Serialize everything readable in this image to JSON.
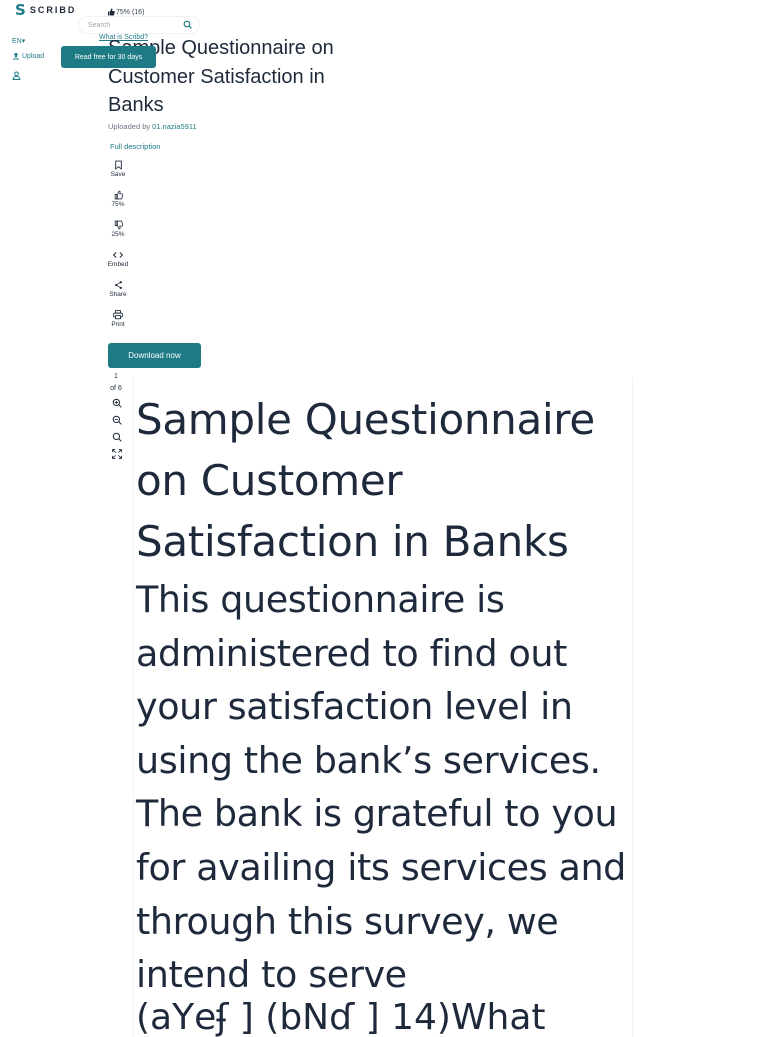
{
  "header": {
    "logo_text": "SCRIBD",
    "rating": "75% (16)",
    "search_placeholder": "Search",
    "what_is_link": "What is Scribd?",
    "language": "EN",
    "upload_label": "Upload",
    "read_free_label": "Read free for 30 days"
  },
  "document": {
    "title": "Sample Questionnaire on Customer Satisfaction in Banks",
    "uploaded_by_label": "Uploaded by",
    "uploader": "01.nazia5911",
    "full_description_label": "Full description"
  },
  "actions": [
    {
      "label": "Save",
      "icon": "bookmark-icon"
    },
    {
      "label": "75%",
      "icon": "thumbs-up-icon"
    },
    {
      "label": "25%",
      "icon": "thumbs-down-icon"
    },
    {
      "label": "Embed",
      "icon": "embed-icon"
    },
    {
      "label": "Share",
      "icon": "share-icon"
    },
    {
      "label": "Print",
      "icon": "print-icon"
    }
  ],
  "download_label": "Download now",
  "pager": {
    "current": "1",
    "total_label": "of 6"
  },
  "zoom_tools": [
    "zoom-in-icon",
    "zoom-out-icon",
    "search-icon",
    "fullscreen-icon"
  ],
  "page": {
    "heading": "Sample Questionnaire on Customer Satisfaction in Banks",
    "body": "This questionnaire is administered to find out your satisfaction level in using the bank’s services. The bank is grateful to you for availing its services and through this survey, we intend to serve",
    "garbled_line": "(aҮeʄ ] (bNɗ ] 14)What"
  },
  "colors": {
    "accent": "#1e7b85",
    "text": "#1e2a3b"
  }
}
